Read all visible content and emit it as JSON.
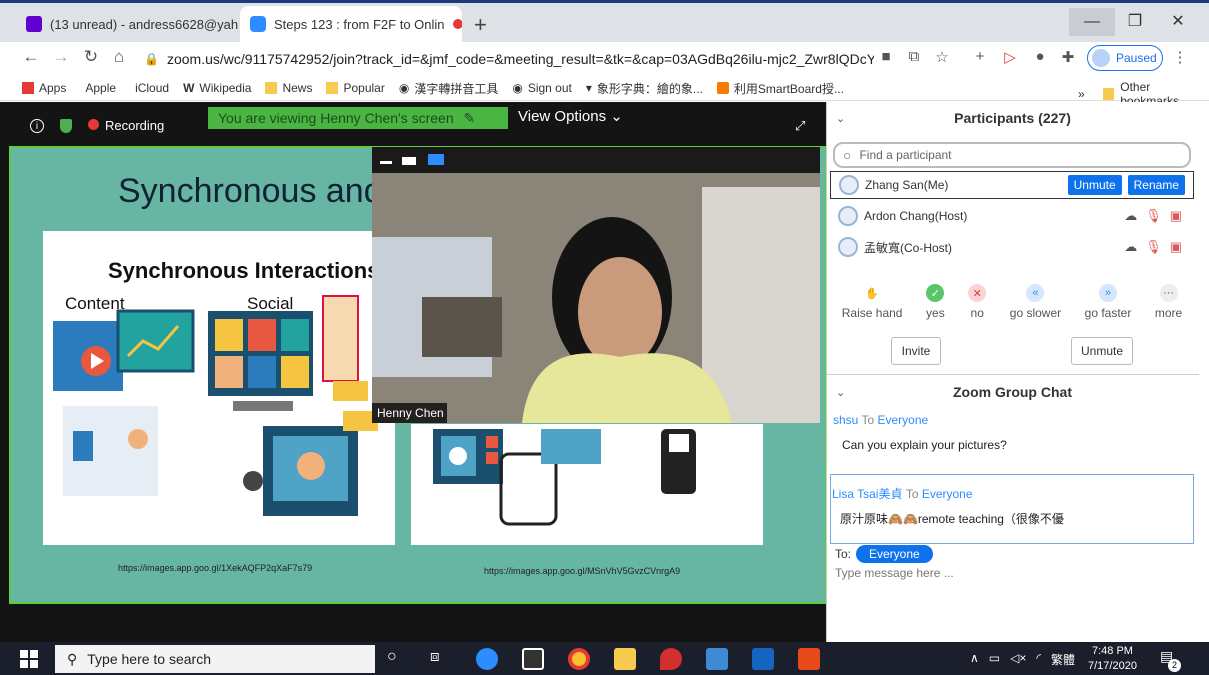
{
  "browser": {
    "tabs": [
      {
        "title": "(13 unread) - andress6628@yaho",
        "active": false
      },
      {
        "title": "Steps 123 : from F2F to Onlin",
        "active": true
      }
    ],
    "new_tab": "+",
    "window_controls": {
      "minimize": "—",
      "maximize": "❐",
      "close": "✕"
    },
    "url": "zoom.us/wc/91175742952/join?track_id=&jmf_code=&meeting_result=&tk=&cap=03AGdBq26ilu-mjc2_Zwr8lQDcYW...",
    "profile_status": "Paused",
    "bookmarks": [
      "Apps",
      "Apple",
      "iCloud",
      "Wikipedia",
      "News",
      "Popular",
      "漢字轉拼音工具",
      "Sign out",
      "象形字典：繪的象...",
      "利用SmartBoard授..."
    ],
    "bookmarks_overflow": "»",
    "other_bookmarks": "Other bookmarks"
  },
  "meeting": {
    "recording_label": "Recording",
    "viewing_banner": "You are viewing Henny Chen's screen",
    "view_options": "View Options ⌄",
    "slide": {
      "title": "Synchronous and",
      "panel_heading": "Synchronous Interactions",
      "col_content": "Content",
      "col_social": "Social",
      "url_left": "https://images.app.goo.gl/1XekAQFP2qXaF7s79",
      "url_right": "https://images.app.goo.gl/MSnVhV5GvzCVnrgA9"
    },
    "video_name": "Henny Chen"
  },
  "participants": {
    "header": "Participants (227)",
    "search_placeholder": "Find a participant",
    "list": [
      {
        "name": "Zhang San(Me)",
        "unmute": "Unmute",
        "rename": "Rename"
      },
      {
        "name": "Ardon Chang(Host)"
      },
      {
        "name": "孟敏寬(Co-Host)"
      }
    ],
    "reactions": [
      {
        "label": "Raise hand",
        "icon": "✋",
        "color": "#f5a623"
      },
      {
        "label": "yes",
        "icon": "✓",
        "color": "#5cc46a"
      },
      {
        "label": "no",
        "icon": "✕",
        "color": "#f26d6d"
      },
      {
        "label": "go slower",
        "icon": "«",
        "color": "#6fa8f5"
      },
      {
        "label": "go faster",
        "icon": "»",
        "color": "#6fa8f5"
      },
      {
        "label": "more",
        "icon": "···",
        "color": "#e6e6e6"
      }
    ],
    "invite": "Invite",
    "unmute_all": "Unmute"
  },
  "chat": {
    "header": "Zoom Group Chat",
    "messages": [
      {
        "from": "shsu",
        "to_word": " To ",
        "to": "Everyone",
        "text": "Can you explain your pictures?"
      },
      {
        "from": "Lisa Tsai美貞",
        "to_word": " To ",
        "to": "Everyone",
        "text": "原汁原味🙈🙈remote teaching（很像不優"
      }
    ],
    "to_label": "To:",
    "recipient": "Everyone",
    "input_placeholder": "Type message here ..."
  },
  "taskbar": {
    "search_placeholder": "Type here to search",
    "time": "7:48 PM",
    "date": "7/17/2020",
    "ime": "繁體",
    "notifications": "2"
  }
}
